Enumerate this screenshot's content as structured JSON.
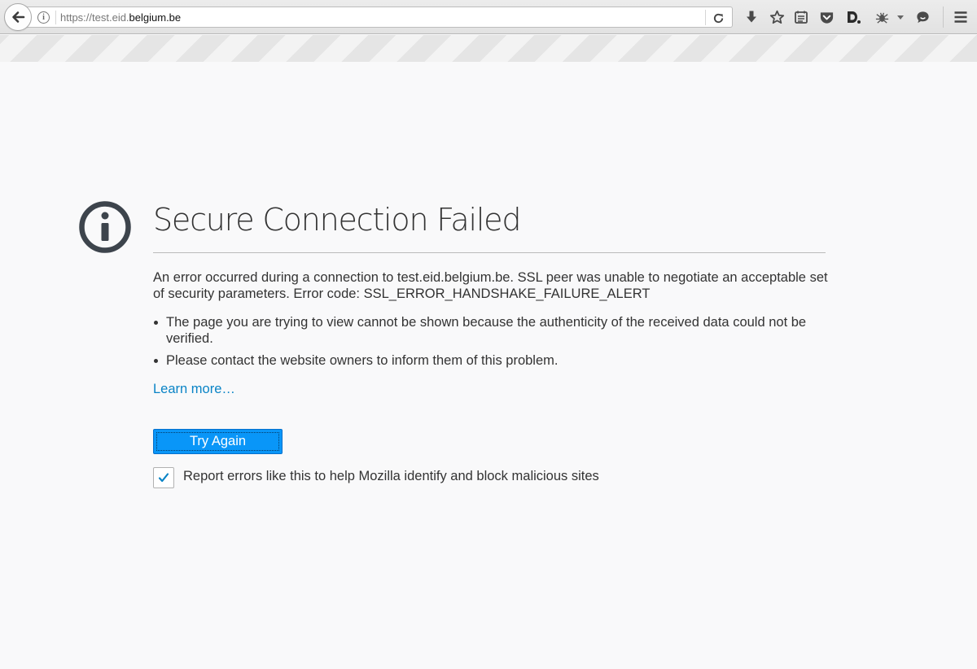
{
  "browser": {
    "url_prefix": "https://test.eid.",
    "url_domain": "belgium.be",
    "toolbar_icons": [
      "back-icon",
      "info-icon",
      "reload-icon",
      "download-icon",
      "bookmark-star-icon",
      "reading-list-icon",
      "pocket-icon",
      "extension-d-icon",
      "extension-bug-icon",
      "dropdown-arrow-icon",
      "chat-bubble-icon",
      "hamburger-menu-icon"
    ]
  },
  "error": {
    "icon": "info-circle-icon",
    "title": "Secure Connection Failed",
    "description": "An error occurred during a connection to test.eid.belgium.be. SSL peer was unable to negotiate an acceptable set of security parameters. Error code: SSL_ERROR_HANDSHAKE_FAILURE_ALERT",
    "bullets": [
      "The page you are trying to view cannot be shown because the authenticity of the received data could not be verified.",
      "Please contact the website owners to inform them of this problem."
    ],
    "learn_more": "Learn more…",
    "try_again": "Try Again",
    "report_checked": true,
    "report_label": "Report errors like this to help Mozilla identify and block malicious sites"
  },
  "colors": {
    "link": "#0a84c6",
    "primary_button": "#0996f8",
    "text": "#333333",
    "icon": "#3d444c"
  }
}
